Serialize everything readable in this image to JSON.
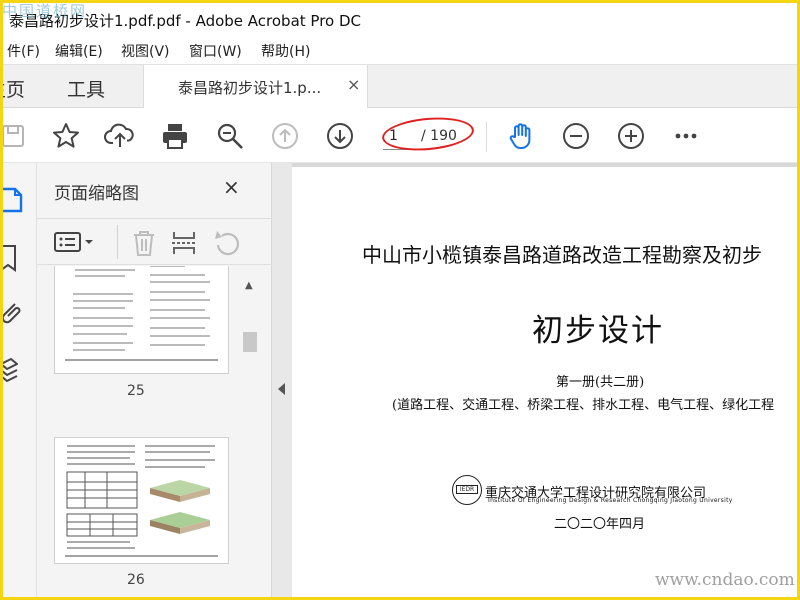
{
  "window": {
    "title": "泰昌路初步设计1.pdf.pdf - Adobe Acrobat Pro DC"
  },
  "watermarks": {
    "top_left": "中国道桥网",
    "bottom_right": "www.cndao.com"
  },
  "menu": [
    "件(F)",
    "编辑(E)",
    "视图(V)",
    "窗口(W)",
    "帮助(H)"
  ],
  "tabs": {
    "home": "主页",
    "tools": "工具",
    "doc": "泰昌路初步设计1.p...",
    "close": "×"
  },
  "toolbar": {
    "page_current": "1",
    "page_total": "/ 190"
  },
  "thumbnails": {
    "title": "页面缩略图",
    "close": "×",
    "pages": [
      {
        "number": "25"
      },
      {
        "number": "26"
      }
    ]
  },
  "document": {
    "line1": "中山市小榄镇泰昌路道路改造工程勘察及初步",
    "line2": "初步设计",
    "line3": "第一册(共二册)",
    "line4": "(道路工程、交通工程、桥梁工程、排水工程、电气工程、绿化工程",
    "company_cn": "重庆交通大学工程设计研究院有限公司",
    "company_en": "Institute Of Engineering Design & Research Chongqing Jiaotong University",
    "seal_text": "IEDR",
    "date": "二〇二〇年四月"
  },
  "colors": {
    "frame": "#f5d511",
    "accent": "#1473e6",
    "annotation": "#e02020"
  }
}
